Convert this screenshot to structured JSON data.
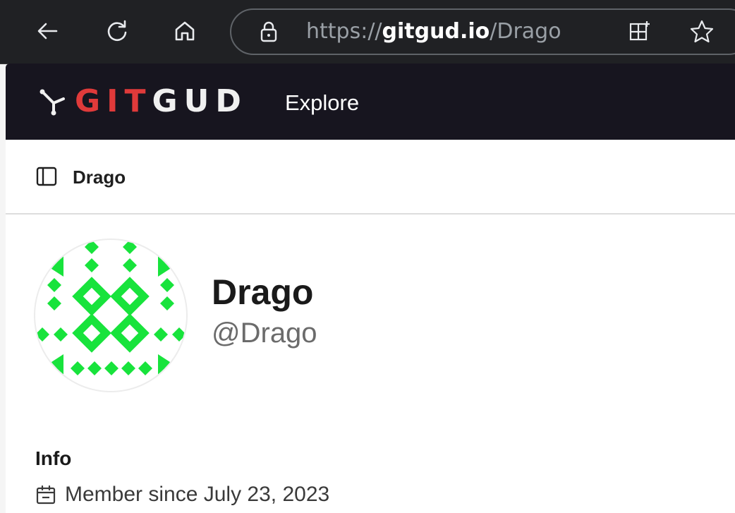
{
  "browser": {
    "url_prefix": "https://",
    "url_host": "gitgud.io",
    "url_path": "/Drago"
  },
  "header": {
    "logo_part1": "GIT",
    "logo_part2": "GUD",
    "nav_explore": "Explore"
  },
  "breadcrumb": {
    "current": "Drago"
  },
  "profile": {
    "name": "Drago",
    "handle": "@Drago",
    "info_title": "Info",
    "member_since": "Member since July 23, 2023"
  },
  "colors": {
    "header_bg": "#17151f",
    "logo_accent": "#e03a3a",
    "avatar_green": "#18e33c"
  }
}
